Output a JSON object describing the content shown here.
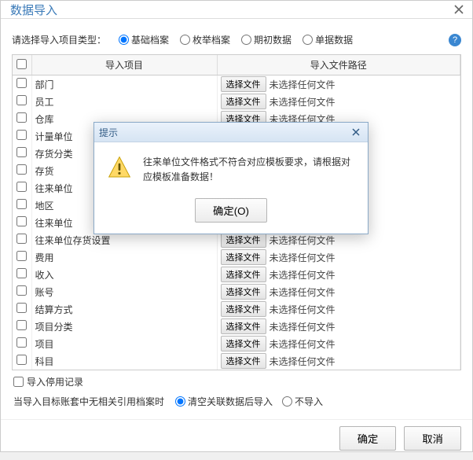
{
  "window": {
    "title": "数据导入"
  },
  "typeRow": {
    "label": "请选择导入项目类型：",
    "options": [
      "基础档案",
      "枚举档案",
      "期初数据",
      "单据数据"
    ],
    "selected": 0
  },
  "table": {
    "cols": {
      "chk": "",
      "item": "导入项目",
      "path": "导入文件路径"
    },
    "fileBtn": "选择文件",
    "noFile": "未选择任何文件",
    "rows": [
      {
        "item": "部门"
      },
      {
        "item": "员工"
      },
      {
        "item": "仓库"
      },
      {
        "item": "计量单位"
      },
      {
        "item": "存货分类"
      },
      {
        "item": "存货"
      },
      {
        "item": "往来单位"
      },
      {
        "item": "地区"
      },
      {
        "item": "往来单位"
      },
      {
        "item": "往来单位存货设置"
      },
      {
        "item": "费用"
      },
      {
        "item": "收入"
      },
      {
        "item": "账号"
      },
      {
        "item": "结算方式"
      },
      {
        "item": "项目分类"
      },
      {
        "item": "项目"
      },
      {
        "item": "科目"
      }
    ]
  },
  "discontinued": {
    "label": "导入停用记录"
  },
  "refHandling": {
    "label": "当导入目标账套中无相关引用档案时",
    "options": [
      "清空关联数据后导入",
      "不导入"
    ],
    "selected": 0
  },
  "footer": {
    "ok": "确定",
    "cancel": "取消"
  },
  "dialog": {
    "title": "提示",
    "message": "往来单位文件格式不符合对应模板要求，请根据对应模板准备数据！",
    "ok": "确定(O)"
  }
}
